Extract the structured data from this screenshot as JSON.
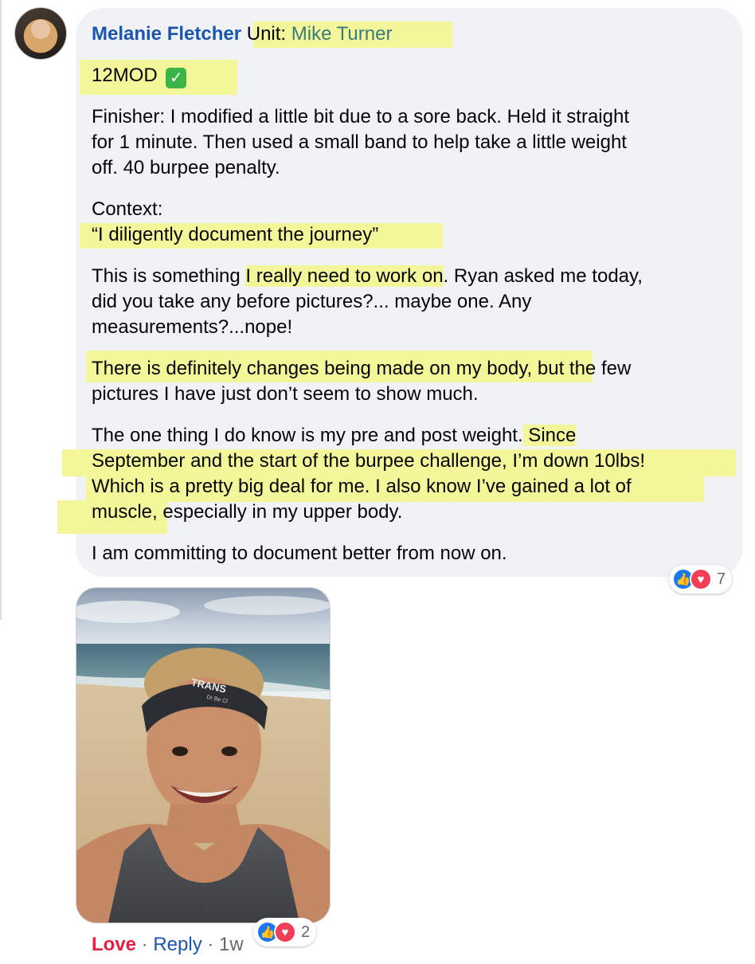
{
  "comment": {
    "author": "Melanie Fletcher",
    "unit_label": " Unit: ",
    "unit_name": "Mike Turner",
    "tag": "12MOD",
    "check_icon": "white-check-mark-icon",
    "finisher": [
      "Finisher: I modified a little bit due to a sore back. Held it straight",
      "for 1 minute. Then used a small band to help take a little weight",
      "off. 40 burpee penalty."
    ],
    "context_label": "Context:",
    "context_quote": "“I diligently document the journey”",
    "para1_a": "This is something ",
    "para1_hl": "I really need to work on",
    "para1_b": ". Ryan asked me today,",
    "para1_l2": "did you take any before pictures?... maybe one. Any",
    "para1_l3": "measurements?...nope!",
    "para2_hl": "There is definitely changes being made on my body,",
    "para2_b": " but the few",
    "para2_l2": "pictures I have just don’t seem to show much.",
    "para3_a": "The one thing I do know is my pre and post weight.",
    "para3_hl1": " Since",
    "para3_l2": "September and the start of the burpee challenge, I’m down 10lbs!",
    "para3_l3": "Which is a pretty big deal for me. I also know I’ve gained a lot of",
    "para3_hl4": "muscle",
    "para3_l4b": ", especially in my upper body.",
    "para4": "I am committing to document better from now on.",
    "reactions_count": "7"
  },
  "photo": {
    "shirt_text": "TRANS",
    "shirt_sub": "Dr Be Cl"
  },
  "actions": {
    "love": "Love",
    "sep": " · ",
    "reply": "Reply",
    "time": "1w",
    "reactions_count": "2"
  },
  "icons": {
    "like": "thumbs-up-icon",
    "love": "heart-icon"
  },
  "colors": {
    "highlight": "#f4f69a",
    "author": "#1a56b0",
    "love": "#e41e3f",
    "like": "#1877f2",
    "bubble": "#f0f2f5"
  }
}
